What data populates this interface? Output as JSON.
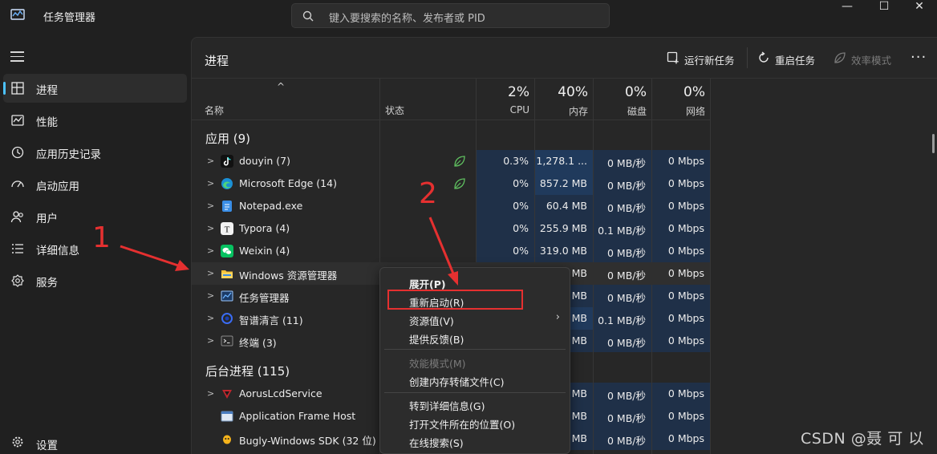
{
  "window": {
    "title": "任务管理器",
    "search_placeholder": "键入要搜索的名称、发布者或 PID",
    "controls": {
      "minimize": "—",
      "maximize": "☐",
      "close": "✕"
    }
  },
  "sidebar": {
    "items": [
      {
        "label": "进程",
        "icon": "processes-icon",
        "active": true
      },
      {
        "label": "性能",
        "icon": "performance-icon"
      },
      {
        "label": "应用历史记录",
        "icon": "history-icon"
      },
      {
        "label": "启动应用",
        "icon": "startup-icon"
      },
      {
        "label": "用户",
        "icon": "users-icon"
      },
      {
        "label": "详细信息",
        "icon": "details-icon"
      },
      {
        "label": "服务",
        "icon": "services-icon"
      }
    ],
    "settings_label": "设置"
  },
  "toolbar": {
    "page_title": "进程",
    "run_new_task": "运行新任务",
    "restart_task": "重启任务",
    "efficiency_mode": "效率模式",
    "more": "···"
  },
  "columns": {
    "name": "名称",
    "status": "状态",
    "sort_caret": "^",
    "cpu": {
      "pct": "2%",
      "label": "CPU"
    },
    "memory": {
      "pct": "40%",
      "label": "内存"
    },
    "disk": {
      "pct": "0%",
      "label": "磁盘"
    },
    "network": {
      "pct": "0%",
      "label": "网络"
    }
  },
  "groups": {
    "apps": "应用 (9)",
    "background": "后台进程 (115)"
  },
  "apps": [
    {
      "name": "douyin (7)",
      "icon": "douyin-icon",
      "leaf": true,
      "cpu": "0.3%",
      "mem": "1,278.1 ...",
      "disk": "0 MB/秒",
      "net": "0 Mbps"
    },
    {
      "name": "Microsoft Edge (14)",
      "icon": "edge-icon",
      "leaf": true,
      "cpu": "0%",
      "mem": "857.2 MB",
      "disk": "0 MB/秒",
      "net": "0 Mbps"
    },
    {
      "name": "Notepad.exe",
      "icon": "notepad-icon",
      "cpu": "0%",
      "mem": "60.4 MB",
      "disk": "0 MB/秒",
      "net": "0 Mbps"
    },
    {
      "name": "Typora (4)",
      "icon": "typora-icon",
      "cpu": "0%",
      "mem": "255.9 MB",
      "disk": "0.1 MB/秒",
      "net": "0 Mbps"
    },
    {
      "name": "Weixin (4)",
      "icon": "weixin-icon",
      "cpu": "0%",
      "mem": "319.0 MB",
      "disk": "0 MB/秒",
      "net": "0 Mbps"
    },
    {
      "name": "Windows 资源管理器",
      "icon": "folder-icon",
      "cpu": "",
      "mem": "MB",
      "disk": "0 MB/秒",
      "net": "0 Mbps"
    },
    {
      "name": "任务管理器",
      "icon": "taskmgr-icon",
      "cpu": "",
      "mem": "MB",
      "disk": "0 MB/秒",
      "net": "0 Mbps"
    },
    {
      "name": "智谱清言 (11)",
      "icon": "zhipu-icon",
      "cpu": "",
      "mem": "MB",
      "disk": "0.1 MB/秒",
      "net": "0 Mbps"
    },
    {
      "name": "终端 (3)",
      "icon": "terminal-icon",
      "cpu": "",
      "mem": "MB",
      "disk": "0 MB/秒",
      "net": "0 Mbps"
    }
  ],
  "background": [
    {
      "name": "AorusLcdService",
      "icon": "aorus-icon",
      "mem": "MB",
      "disk": "0 MB/秒",
      "net": "0 Mbps"
    },
    {
      "name": "Application Frame Host",
      "icon": "appframe-icon",
      "mem": "MB",
      "disk": "0 MB/秒",
      "net": "0 Mbps"
    },
    {
      "name": "Bugly-Windows SDK (32 位)",
      "icon": "bugly-icon",
      "mem": "MB",
      "disk": "0 MB/秒",
      "net": "0 Mbps"
    }
  ],
  "context_menu": {
    "expand": "展开(P)",
    "restart": "重新启动(R)",
    "resource_values": "资源值(V)",
    "feedback": "提供反馈(B)",
    "efficiency": "效能模式(M)",
    "dump": "创建内存转储文件(C)",
    "goto_details": "转到详细信息(G)",
    "open_location": "打开文件所在的位置(O)",
    "search_online": "在线搜索(S)"
  },
  "annotations": {
    "num1": "1",
    "num2": "2",
    "color": "#e53030"
  },
  "watermark": "CSDN @聂 可 以",
  "colors": {
    "accent": "#4cc2ff",
    "heat_dark": "#1f3048",
    "heat_mid": "#203a5c",
    "leaf": "#5fbf5f"
  }
}
